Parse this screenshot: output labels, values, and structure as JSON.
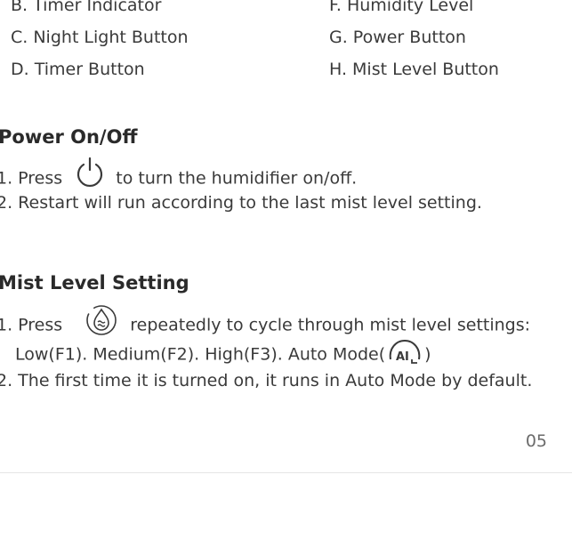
{
  "legend": {
    "left": [
      "B. Timer Indicator",
      "C. Night Light Button",
      "D. Timer Button"
    ],
    "right": [
      "F. Humidity Level",
      "G. Power Button",
      "H. Mist Level Button"
    ]
  },
  "power_section": {
    "title": "Power On/Off",
    "step1_prefix": "1.  Press",
    "step1_suffix": " to turn the humidifier on/off.",
    "step2": "2. Restart will run according to the last mist level setting.",
    "icon": "power-icon"
  },
  "mist_section": {
    "title": "Mist Level Setting",
    "step1_prefix": "1. Press",
    "step1_suffix": " repeatedly to cycle through mist level settings:",
    "step1_line2_prefix": "Low(F1). Medium(F2). High(F3). Auto Mode(",
    "step1_line2_suffix": ")",
    "auto_icon_label": "AI",
    "step2": "2. The first time it is turned on, it runs in Auto Mode by default.",
    "icon": "mist-level-icon",
    "auto_icon": "auto-mode-icon"
  },
  "footer": {
    "page_number": "05"
  },
  "colors": {
    "text": "#3a3a3a",
    "heading": "#2a2a2a",
    "page_number": "#6b6b6b",
    "divider": "#e6e6e6"
  }
}
